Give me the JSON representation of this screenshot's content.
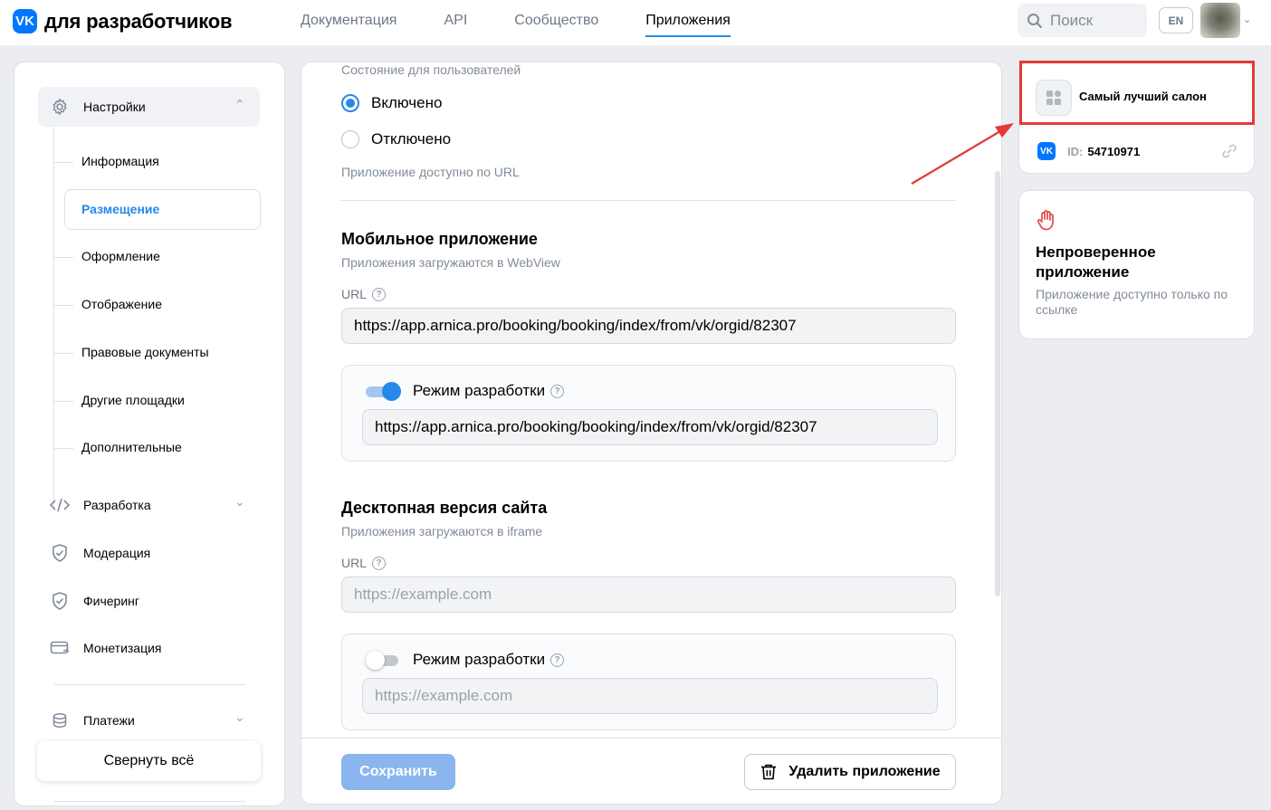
{
  "header": {
    "logo_mark": "VK",
    "logo_text": "для разработчиков",
    "nav": [
      "Документация",
      "API",
      "Сообщество",
      "Приложения"
    ],
    "nav_active": "Приложения",
    "search_placeholder": "Поиск",
    "lang": "EN"
  },
  "sidebar": {
    "settings_label": "Настройки",
    "sub_items": [
      "Информация",
      "Размещение",
      "Оформление",
      "Отображение",
      "Правовые документы",
      "Другие площадки",
      "Дополнительные"
    ],
    "active_sub": "Размещение",
    "groups": [
      "Разработка",
      "Модерация",
      "Фичеринг",
      "Монетизация",
      "Платежи"
    ],
    "collapse_label": "Свернуть всё"
  },
  "main": {
    "state_label": "Состояние для пользователей",
    "radio_on": "Включено",
    "radio_off": "Отключено",
    "state_hint": "Приложение доступно по URL",
    "mobile": {
      "title": "Мобильное приложение",
      "subtitle": "Приложения загружаются в WebView",
      "url_label": "URL",
      "url_value": "https://app.arnica.pro/booking/booking/index/from/vk/orgid/82307",
      "dev_mode_label": "Режим разработки",
      "dev_mode_on": true,
      "dev_url_value": "https://app.arnica.pro/booking/booking/index/from/vk/orgid/82307"
    },
    "desktop": {
      "title": "Десктопная версия сайта",
      "subtitle": "Приложения загружаются в iframe",
      "url_label": "URL",
      "url_placeholder": "https://example.com",
      "dev_mode_label": "Режим разработки",
      "dev_mode_on": false,
      "dev_url_placeholder": "https://example.com"
    },
    "save_label": "Сохранить",
    "delete_label": "Удалить приложение"
  },
  "app_card": {
    "name": "Самый лучший салон",
    "id_label": "ID:",
    "id_value": "54710971"
  },
  "warning_card": {
    "title": "Непроверенное приложение",
    "description": "Приложение доступно только по ссылке"
  },
  "colors": {
    "accent": "#2688eb",
    "brand": "#0077ff",
    "highlight": "#e53935",
    "warning_icon": "#e64646"
  }
}
